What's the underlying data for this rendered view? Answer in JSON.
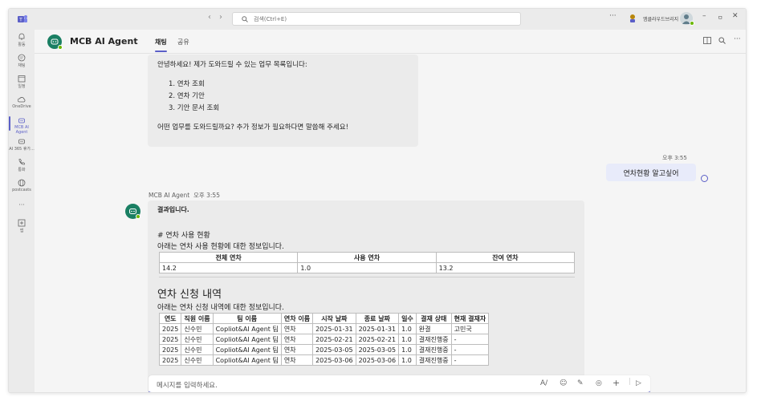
{
  "titlebar": {
    "search_placeholder": "검색(Ctrl+E)",
    "nav_back": "‹",
    "nav_forward": "›",
    "more": "···",
    "org_name": "엠클라우드브리지",
    "minimize": "–",
    "maximize": "ㅁ",
    "close": "✕"
  },
  "rail": {
    "items": [
      {
        "label": "활동",
        "icon": "bell-icon"
      },
      {
        "label": "채팅",
        "icon": "chat-icon"
      },
      {
        "label": "일정",
        "icon": "calendar-icon"
      },
      {
        "label": "OneDrive",
        "icon": "cloud-icon"
      },
      {
        "label": "MCB AI Agent",
        "icon": "bot-icon"
      },
      {
        "label": "AI 365 휴가...",
        "icon": "bot-icon"
      },
      {
        "label": "통화",
        "icon": "phone-icon"
      },
      {
        "label": "postcasts",
        "icon": "globe-icon"
      },
      {
        "label": "···",
        "icon": "more-icon"
      },
      {
        "label": "앱",
        "icon": "apps-icon"
      }
    ],
    "active_index": 4
  },
  "header": {
    "title": "MCB AI Agent",
    "tabs": [
      {
        "label": "채팅",
        "active": true
      },
      {
        "label": "공유",
        "active": false
      }
    ]
  },
  "messages": {
    "first": {
      "intro": "안녕하세요! 제가 도와드릴 수 있는 업무 목록입니다:",
      "items": [
        "1. 연차 조회",
        "2. 연차 기안",
        "3. 기안 문서 조회"
      ],
      "outro": "어떤 업무를 도와드릴까요? 추가 정보가 필요하다면 말씀해 주세요!"
    },
    "user": {
      "time": "오후 3:55",
      "text": "연차현황 알고싶어"
    },
    "reply": {
      "sender": "MCB AI Agent",
      "time": "오후 3:55",
      "lead": "결과입니다.",
      "heading1": "# 연차 사용 현황",
      "desc1": "아래는 연차 사용 현황에 대한 정보입니다.",
      "summary_headers": [
        "전체 연차",
        "사용 연차",
        "잔여 연차"
      ],
      "summary_values": [
        "14.2",
        "1.0",
        "13.2"
      ],
      "heading2": "연차 신청 내역",
      "desc2": "아래는 연차 신청 내역에 대한 정보입니다.",
      "detail_headers": [
        "연도",
        "직원 이름",
        "팀 이름",
        "연차 이름",
        "시작 날짜",
        "종료 날짜",
        "일수",
        "결재 상태",
        "현재 결재자"
      ],
      "detail_rows": [
        [
          "2025",
          "신수민",
          "Copliot&AI Agent 팀",
          "연차",
          "2025-01-31",
          "2025-01-31",
          "1.0",
          "완결",
          "고민국"
        ],
        [
          "2025",
          "신수민",
          "Copliot&AI Agent 팀",
          "연차",
          "2025-02-21",
          "2025-02-21",
          "1.0",
          "결재진행중",
          "-"
        ],
        [
          "2025",
          "신수민",
          "Copliot&AI Agent 팀",
          "연차",
          "2025-03-05",
          "2025-03-05",
          "1.0",
          "결재진행중",
          "-"
        ],
        [
          "2025",
          "신수민",
          "Copliot&AI Agent 팀",
          "연차",
          "2025-03-06",
          "2025-03-06",
          "1.0",
          "결재진행중",
          "-"
        ]
      ]
    }
  },
  "composer": {
    "placeholder": "메시지를 입력하세요."
  },
  "colors": {
    "accent": "#5b5fc7",
    "bot": "#1a7f63",
    "online": "#6bb700"
  }
}
